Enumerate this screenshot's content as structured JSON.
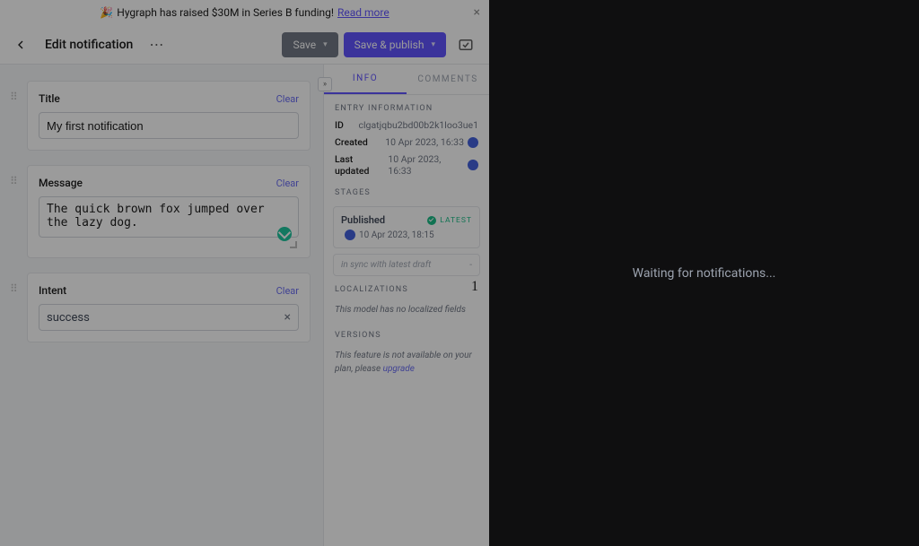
{
  "announce": {
    "emoji": "🎉",
    "text": "Hygraph has raised $30M in Series B funding!",
    "link": "Read more"
  },
  "header": {
    "title": "Edit notification",
    "save": "Save",
    "publish": "Save & publish"
  },
  "form": {
    "title": {
      "label": "Title",
      "clear": "Clear",
      "value": "My first notification"
    },
    "message": {
      "label": "Message",
      "clear": "Clear",
      "value": "The quick brown fox jumped over the lazy dog."
    },
    "intent": {
      "label": "Intent",
      "clear": "Clear",
      "value": "success"
    }
  },
  "sidebar": {
    "tabs": {
      "info": "INFO",
      "comments": "COMMENTS"
    },
    "entry": {
      "heading": "ENTRY INFORMATION",
      "id_label": "ID",
      "id_value": "clgatjqbu2bd00b2k1loo3ue1",
      "created_label": "Created",
      "created_value": "10 Apr 2023, 16:33",
      "updated_label": "Last updated",
      "updated_value": "10 Apr 2023, 16:33"
    },
    "stages": {
      "heading": "STAGES",
      "published": "Published",
      "latest": "LATEST",
      "date": "10 Apr 2023, 18:15",
      "sync": "in sync with latest draft",
      "dash": "-"
    },
    "localizations": {
      "heading": "LOCALIZATIONS",
      "count": "1",
      "note": "This model has no localized fields"
    },
    "versions": {
      "heading": "VERSIONS",
      "note_pre": "This feature is not available on your plan, please ",
      "upgrade": "upgrade"
    }
  },
  "panel": {
    "waiting": "Waiting for notifications..."
  }
}
